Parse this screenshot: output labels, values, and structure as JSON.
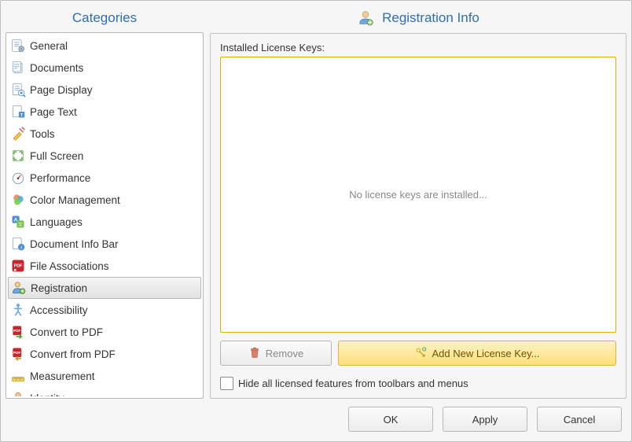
{
  "left": {
    "title": "Categories",
    "items": [
      {
        "label": "General",
        "icon": "general",
        "selected": false
      },
      {
        "label": "Documents",
        "icon": "documents",
        "selected": false
      },
      {
        "label": "Page Display",
        "icon": "page-display",
        "selected": false
      },
      {
        "label": "Page Text",
        "icon": "page-text",
        "selected": false
      },
      {
        "label": "Tools",
        "icon": "tools",
        "selected": false
      },
      {
        "label": "Full Screen",
        "icon": "full-screen",
        "selected": false
      },
      {
        "label": "Performance",
        "icon": "performance",
        "selected": false
      },
      {
        "label": "Color Management",
        "icon": "color-management",
        "selected": false
      },
      {
        "label": "Languages",
        "icon": "languages",
        "selected": false
      },
      {
        "label": "Document Info Bar",
        "icon": "info-bar",
        "selected": false
      },
      {
        "label": "File Associations",
        "icon": "file-assoc",
        "selected": false
      },
      {
        "label": "Registration",
        "icon": "registration",
        "selected": true
      },
      {
        "label": "Accessibility",
        "icon": "accessibility",
        "selected": false
      },
      {
        "label": "Convert to PDF",
        "icon": "convert-to-pdf",
        "selected": false
      },
      {
        "label": "Convert from PDF",
        "icon": "convert-from-pdf",
        "selected": false
      },
      {
        "label": "Measurement",
        "icon": "measurement",
        "selected": false
      },
      {
        "label": "Identity",
        "icon": "identity",
        "selected": false
      }
    ]
  },
  "right": {
    "title": "Registration Info",
    "installed_label": "Installed License Keys:",
    "empty_text": "No license keys are installed...",
    "remove_label": "Remove",
    "add_label": "Add New License Key...",
    "hide_label": "Hide all licensed features from toolbars and menus",
    "hide_checked": false
  },
  "footer": {
    "ok": "OK",
    "apply": "Apply",
    "cancel": "Cancel"
  }
}
